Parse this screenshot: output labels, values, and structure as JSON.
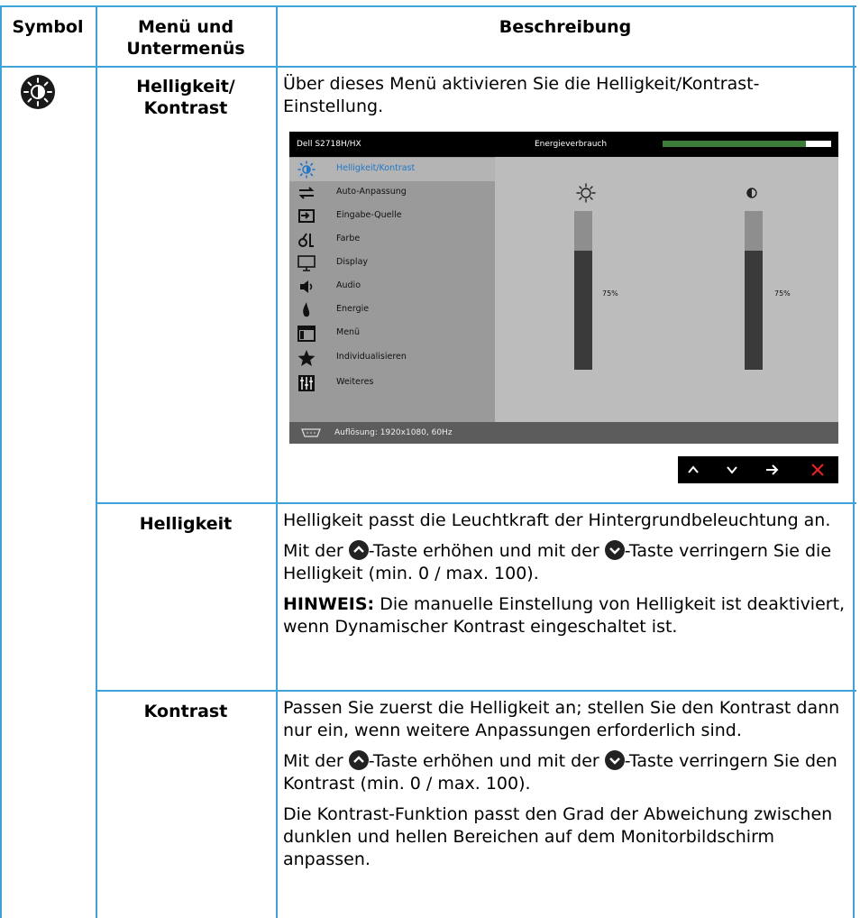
{
  "table": {
    "headers": {
      "symbol": "Symbol",
      "menu": "Menü und Untermenüs",
      "description": "Beschreibung"
    },
    "rows": [
      {
        "menu": "Helligkeit/ Kontrast",
        "description": "Über dieses Menü aktivieren Sie die Helligkeit/Kontrast-Einstellung."
      },
      {
        "menu": "Helligkeit",
        "paragraphs": [
          "Helligkeit passt die Leuchtkraft der Hintergrundbeleuchtung an.",
          {
            "before": "Mit der ",
            "middle": "-Taste erhöhen und mit der ",
            "after": "-Taste verringern Sie die Helligkeit (min. 0 / max. 100)."
          },
          {
            "bold": "HINWEIS:",
            "text": " Die manuelle Einstellung von Helligkeit ist deaktiviert, wenn Dynamischer Kontrast eingeschaltet ist."
          }
        ]
      },
      {
        "menu": "Kontrast",
        "paragraphs": [
          "Passen Sie zuerst die Helligkeit an; stellen Sie den Kontrast dann nur ein, wenn weitere Anpassungen erforderlich sind.",
          {
            "before": "Mit der ",
            "middle": "-Taste erhöhen und mit der ",
            "after": "-Taste verringern Sie den Kontrast (min. 0 / max. 100)."
          },
          "Die Kontrast-Funktion passt den Grad der Abweichung zwischen dunklen und hellen Bereichen auf dem Monitorbildschirm anpassen."
        ]
      }
    ]
  },
  "osd": {
    "model": "Dell S2718H/HX",
    "energy_label": "Energieverbrauch",
    "energy_level": 0.85,
    "menu_items": [
      {
        "label": "Helligkeit/Kontrast",
        "icon": "brightness-icon"
      },
      {
        "label": "Auto-Anpassung",
        "icon": "auto-adjust-icon"
      },
      {
        "label": "Eingabe-Quelle",
        "icon": "input-source-icon"
      },
      {
        "label": "Farbe",
        "icon": "color-icon"
      },
      {
        "label": "Display",
        "icon": "display-icon"
      },
      {
        "label": "Audio",
        "icon": "speaker-icon"
      },
      {
        "label": "Energie",
        "icon": "energy-icon"
      },
      {
        "label": "Menü",
        "icon": "menu-icon"
      },
      {
        "label": "Individualisieren",
        "icon": "star-icon"
      },
      {
        "label": "Weiteres",
        "icon": "others-icon"
      }
    ],
    "brightness": {
      "value": 75,
      "label": "75%"
    },
    "contrast": {
      "value": 75,
      "label": "75%"
    },
    "resolution": "Auflösung: 1920x1080, 60Hz",
    "nav_buttons": [
      "up-arrow-icon",
      "down-arrow-icon",
      "right-arrow-icon",
      "close-icon"
    ],
    "colors": {
      "selected_text": "#2377c8",
      "energy_bar": "#3c7d3a",
      "close": "#e02424"
    }
  },
  "colors": {
    "table_rule": "#3fa3da"
  }
}
